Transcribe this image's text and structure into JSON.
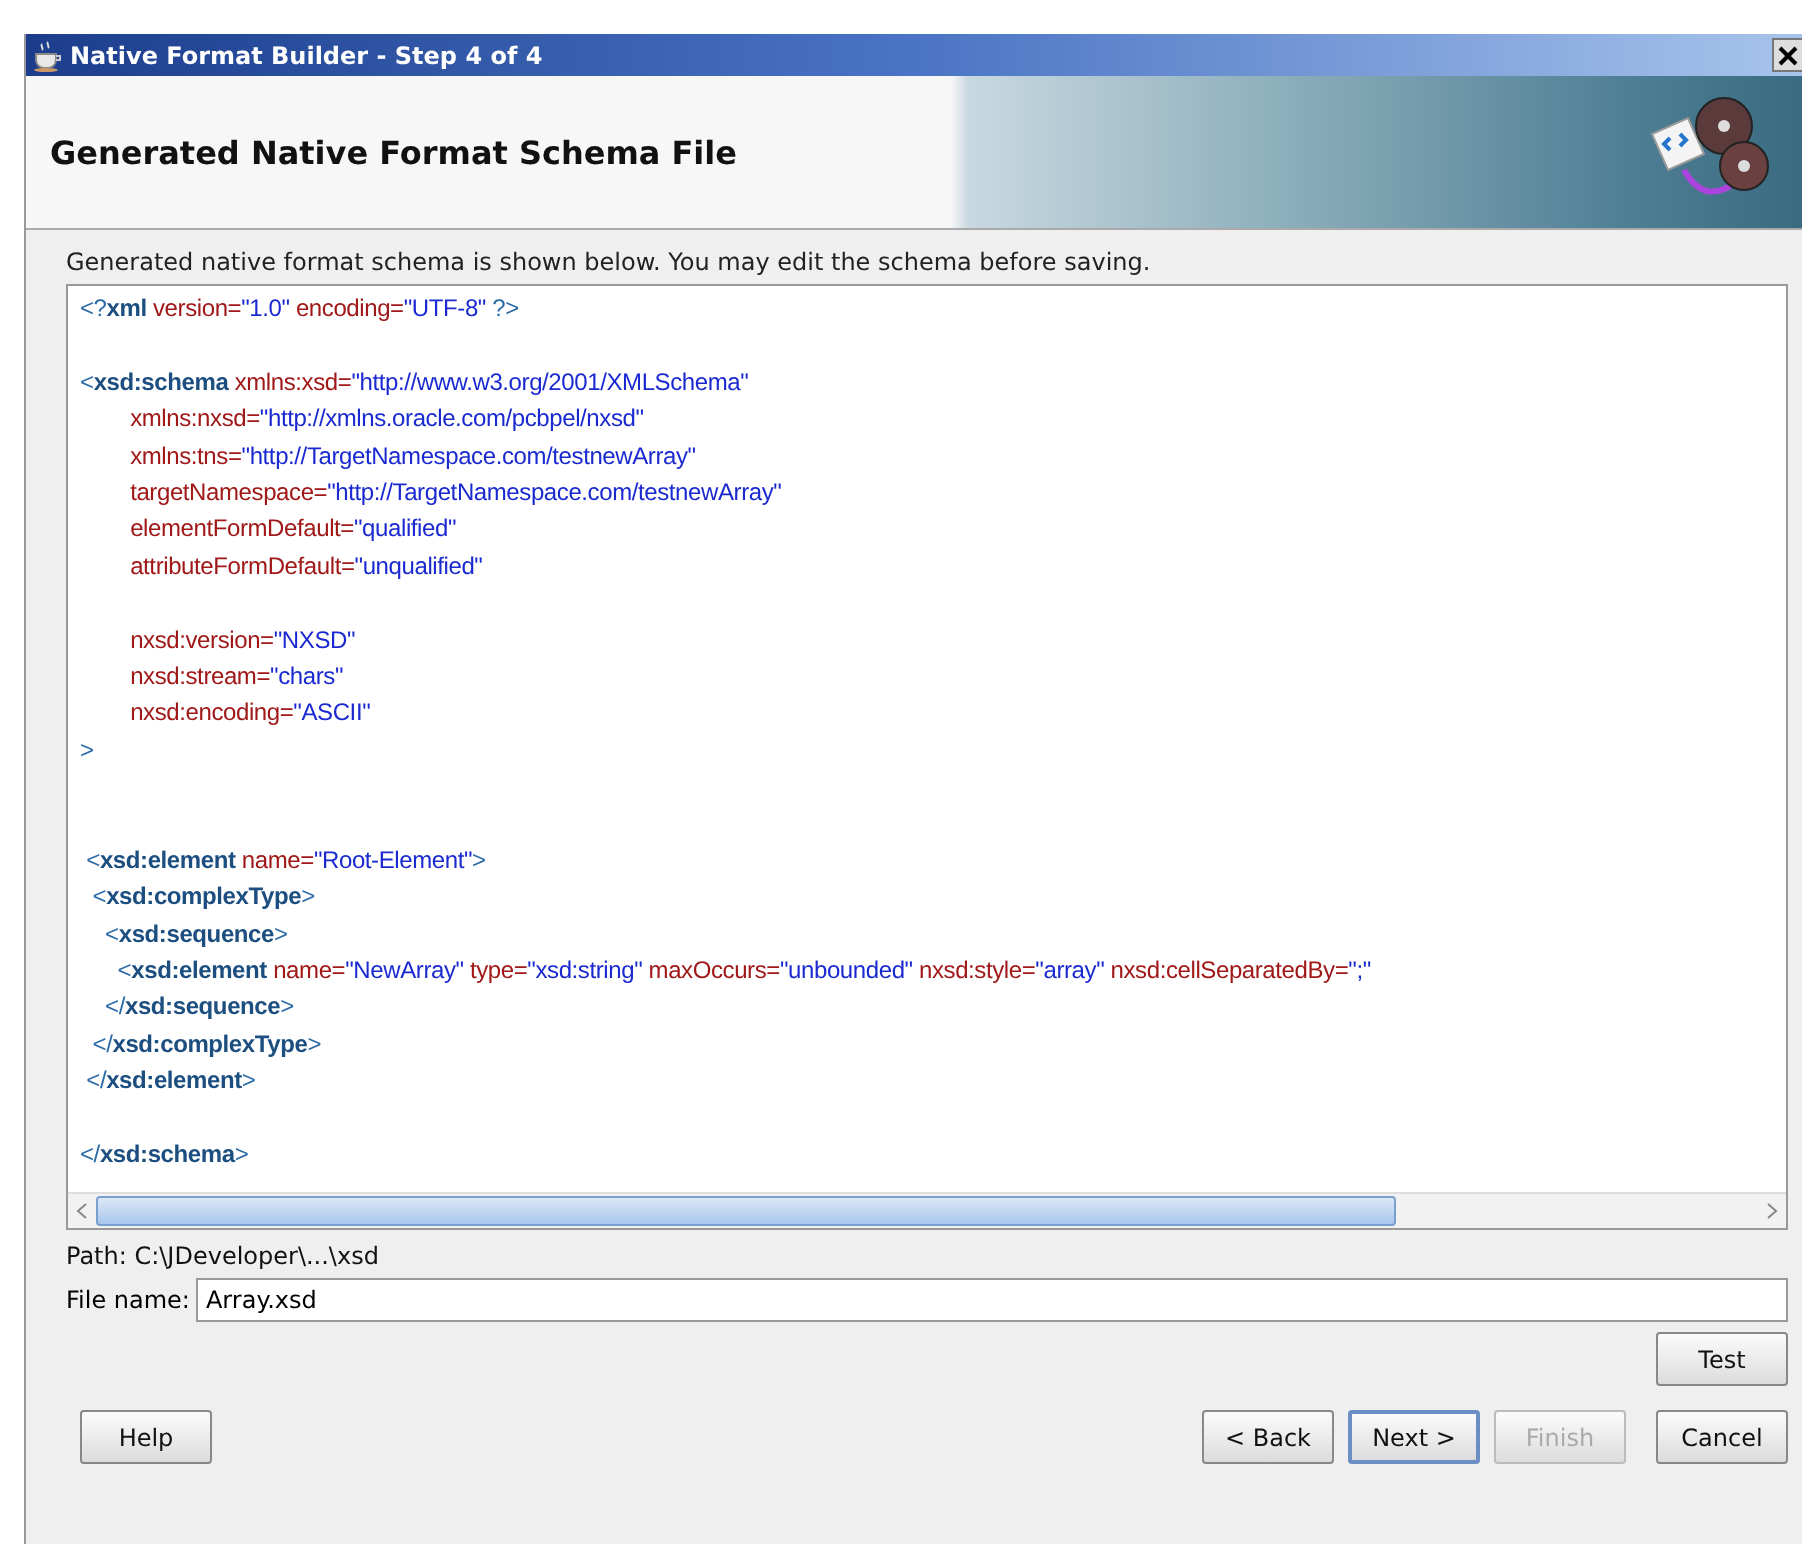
{
  "window": {
    "title": "Native Format Builder - Step 4 of 4"
  },
  "banner": {
    "title": "Generated Native Format Schema File"
  },
  "instructions": "Generated native format schema is shown below. You may edit the schema before saving.",
  "editor": {
    "lines": [
      {
        "tokens": [
          {
            "kind": "punct",
            "text": "<?"
          },
          {
            "kind": "tag",
            "text": "xml"
          },
          {
            "kind": "attr",
            "text": " version="
          },
          {
            "kind": "value",
            "text": "\"1.0\""
          },
          {
            "kind": "attr",
            "text": " encoding="
          },
          {
            "kind": "value",
            "text": "\"UTF-8\""
          },
          {
            "kind": "punct",
            "text": " ?>"
          }
        ]
      },
      {
        "blank_line_before": true,
        "tokens": [
          {
            "kind": "punct",
            "text": "<"
          },
          {
            "kind": "tag",
            "text": "xsd:schema"
          },
          {
            "kind": "attr",
            "text": " xmlns:xsd="
          },
          {
            "kind": "value",
            "text": "\"http://www.w3.org/2001/XMLSchema\""
          }
        ]
      },
      {
        "tokens": [
          {
            "kind": "attr",
            "text": "        xmlns:nxsd="
          },
          {
            "kind": "value",
            "text": "\"http://xmlns.oracle.com/pcbpel/nxsd\""
          }
        ]
      },
      {
        "tokens": [
          {
            "kind": "attr",
            "text": "        xmlns:tns="
          },
          {
            "kind": "value",
            "text": "\"http://TargetNamespace.com/testnewArray\""
          }
        ]
      },
      {
        "tokens": [
          {
            "kind": "attr",
            "text": "        targetNamespace="
          },
          {
            "kind": "value",
            "text": "\"http://TargetNamespace.com/testnewArray\""
          }
        ]
      },
      {
        "tokens": [
          {
            "kind": "attr",
            "text": "        elementFormDefault="
          },
          {
            "kind": "value",
            "text": "\"qualified\""
          }
        ]
      },
      {
        "tokens": [
          {
            "kind": "attr",
            "text": "        attributeFormDefault="
          },
          {
            "kind": "value",
            "text": "\"unqualified\""
          }
        ]
      },
      {
        "blank_line_before": true,
        "tokens": [
          {
            "kind": "attr",
            "text": "        nxsd:version="
          },
          {
            "kind": "value",
            "text": "\"NXSD\""
          }
        ]
      },
      {
        "tokens": [
          {
            "kind": "attr",
            "text": "        nxsd:stream="
          },
          {
            "kind": "value",
            "text": "\"chars\""
          }
        ]
      },
      {
        "tokens": [
          {
            "kind": "attr",
            "text": "        nxsd:encoding="
          },
          {
            "kind": "value",
            "text": "\"ASCII\""
          }
        ]
      },
      {
        "tokens": [
          {
            "kind": "punct",
            "text": ">"
          }
        ]
      },
      {
        "blank_line_before": true,
        "second_blank_line": true,
        "tokens": [
          {
            "kind": "punct",
            "text": " <"
          },
          {
            "kind": "tag",
            "text": "xsd:element"
          },
          {
            "kind": "attr",
            "text": " name="
          },
          {
            "kind": "value",
            "text": "\"Root-Element\""
          },
          {
            "kind": "punct",
            "text": ">"
          }
        ]
      },
      {
        "tokens": [
          {
            "kind": "punct",
            "text": "  <"
          },
          {
            "kind": "tag",
            "text": "xsd:complexType"
          },
          {
            "kind": "punct",
            "text": ">"
          }
        ]
      },
      {
        "tokens": [
          {
            "kind": "punct",
            "text": "    <"
          },
          {
            "kind": "tag",
            "text": "xsd:sequence"
          },
          {
            "kind": "punct",
            "text": ">"
          }
        ]
      },
      {
        "tokens": [
          {
            "kind": "punct",
            "text": "      <"
          },
          {
            "kind": "tag",
            "text": "xsd:element"
          },
          {
            "kind": "attr",
            "text": " name="
          },
          {
            "kind": "value",
            "text": "\"NewArray\""
          },
          {
            "kind": "attr",
            "text": " type="
          },
          {
            "kind": "value",
            "text": "\"xsd:string\""
          },
          {
            "kind": "attr",
            "text": " maxOccurs="
          },
          {
            "kind": "value",
            "text": "\"unbounded\""
          },
          {
            "kind": "attr",
            "text": " nxsd:style="
          },
          {
            "kind": "value",
            "text": "\"array\""
          },
          {
            "kind": "attr",
            "text": " nxsd:cellSeparatedBy="
          },
          {
            "kind": "value",
            "text": "\";\""
          }
        ]
      },
      {
        "tokens": [
          {
            "kind": "punct",
            "text": "    </"
          },
          {
            "kind": "tag",
            "text": "xsd:sequence"
          },
          {
            "kind": "punct",
            "text": ">"
          }
        ]
      },
      {
        "tokens": [
          {
            "kind": "punct",
            "text": "  </"
          },
          {
            "kind": "tag",
            "text": "xsd:complexType"
          },
          {
            "kind": "punct",
            "text": ">"
          }
        ]
      },
      {
        "tokens": [
          {
            "kind": "punct",
            "text": " </"
          },
          {
            "kind": "tag",
            "text": "xsd:element"
          },
          {
            "kind": "punct",
            "text": ">"
          }
        ]
      },
      {
        "blank_line_before": true,
        "tokens": [
          {
            "kind": "punct",
            "text": "</"
          },
          {
            "kind": "tag",
            "text": "xsd:schema"
          },
          {
            "kind": "punct",
            "text": ">"
          }
        ]
      }
    ]
  },
  "path": "Path: C:\\JDeveloper\\...\\xsd",
  "file_name": {
    "label": "File name:",
    "value": "Array.xsd"
  },
  "buttons": {
    "test": "Test",
    "help": "Help",
    "back": "< Back",
    "next": "Next >",
    "finish": "Finish",
    "cancel": "Cancel"
  },
  "finish_disabled": true
}
